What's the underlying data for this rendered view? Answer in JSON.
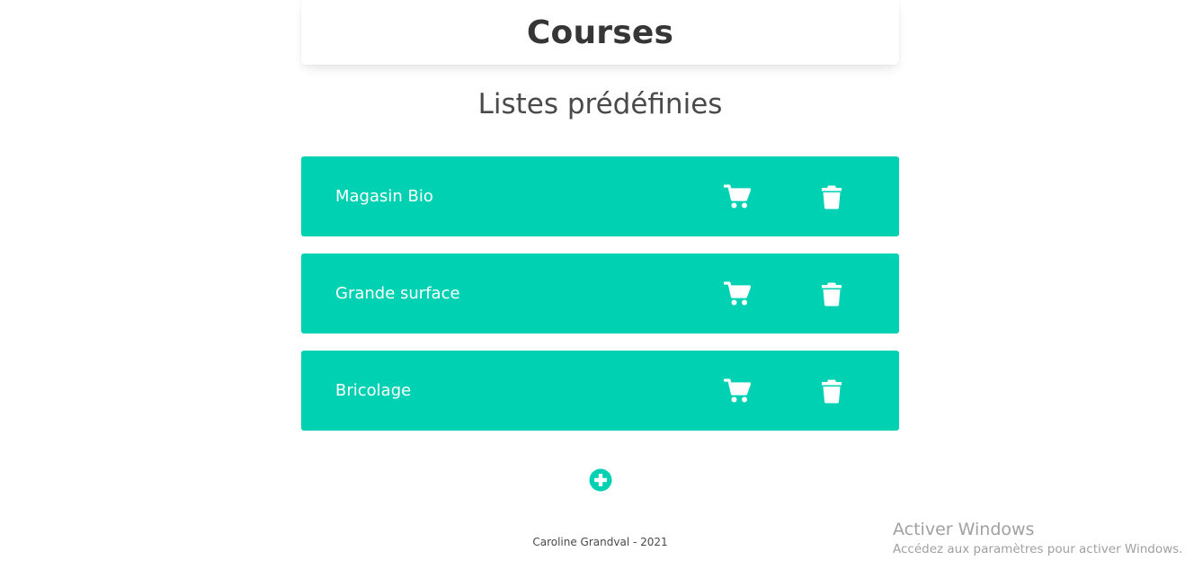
{
  "header": {
    "title": "Courses"
  },
  "section": {
    "title": "Listes prédéfinies"
  },
  "lists": [
    {
      "label": "Magasin Bio"
    },
    {
      "label": "Grande surface"
    },
    {
      "label": "Bricolage"
    }
  ],
  "icons": {
    "cart": "shopping-cart-icon",
    "trash": "trash-icon",
    "add": "plus-circle-icon"
  },
  "colors": {
    "accent": "#00d1b2",
    "text": "#363636"
  },
  "footer": {
    "text": "Caroline Grandval - 2021"
  },
  "watermark": {
    "title": "Activer Windows",
    "subtitle": "Accédez aux paramètres pour activer Windows."
  }
}
